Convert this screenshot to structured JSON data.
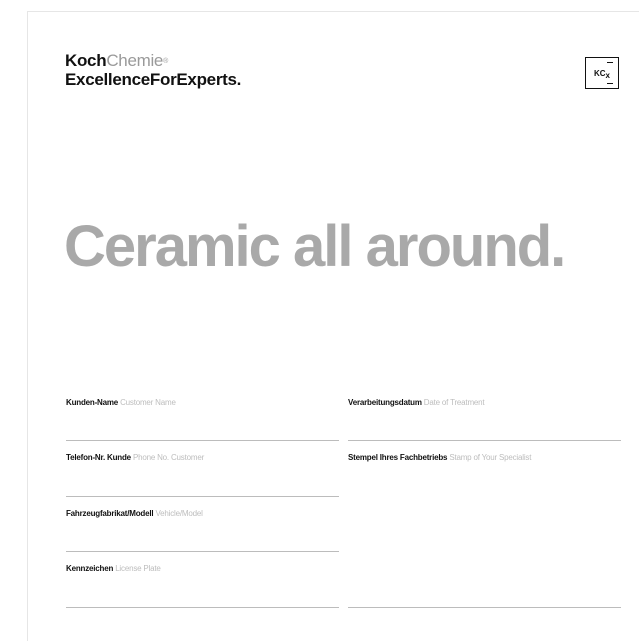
{
  "brand": {
    "name_bold": "Koch",
    "name_light": "Chemie",
    "registered": "®",
    "tagline": "ExcellenceForExperts."
  },
  "logo": {
    "letters": "KC",
    "subscript": "x"
  },
  "headline": "Ceramic all around.",
  "fields": {
    "customer_name": {
      "label_de": "Kunden-Name",
      "label_en": "Customer Name"
    },
    "phone": {
      "label_de": "Telefon-Nr. Kunde",
      "label_en": "Phone No. Customer"
    },
    "vehicle": {
      "label_de": "Fahrzeugfabrikat/Modell",
      "label_en": "Vehicle/Model"
    },
    "license": {
      "label_de": "Kennzeichen",
      "label_en": "License Plate"
    },
    "date": {
      "label_de": "Verarbeitungsdatum",
      "label_en": "Date of Treatment"
    },
    "stamp": {
      "label_de": "Stempel Ihres Fachbetriebs",
      "label_en": "Stamp of Your Specialist"
    }
  },
  "colors": {
    "headline": "#a9a9a9",
    "text_dark": "#111111",
    "text_light": "#bdbdbd",
    "rule": "#bcbcbc"
  }
}
